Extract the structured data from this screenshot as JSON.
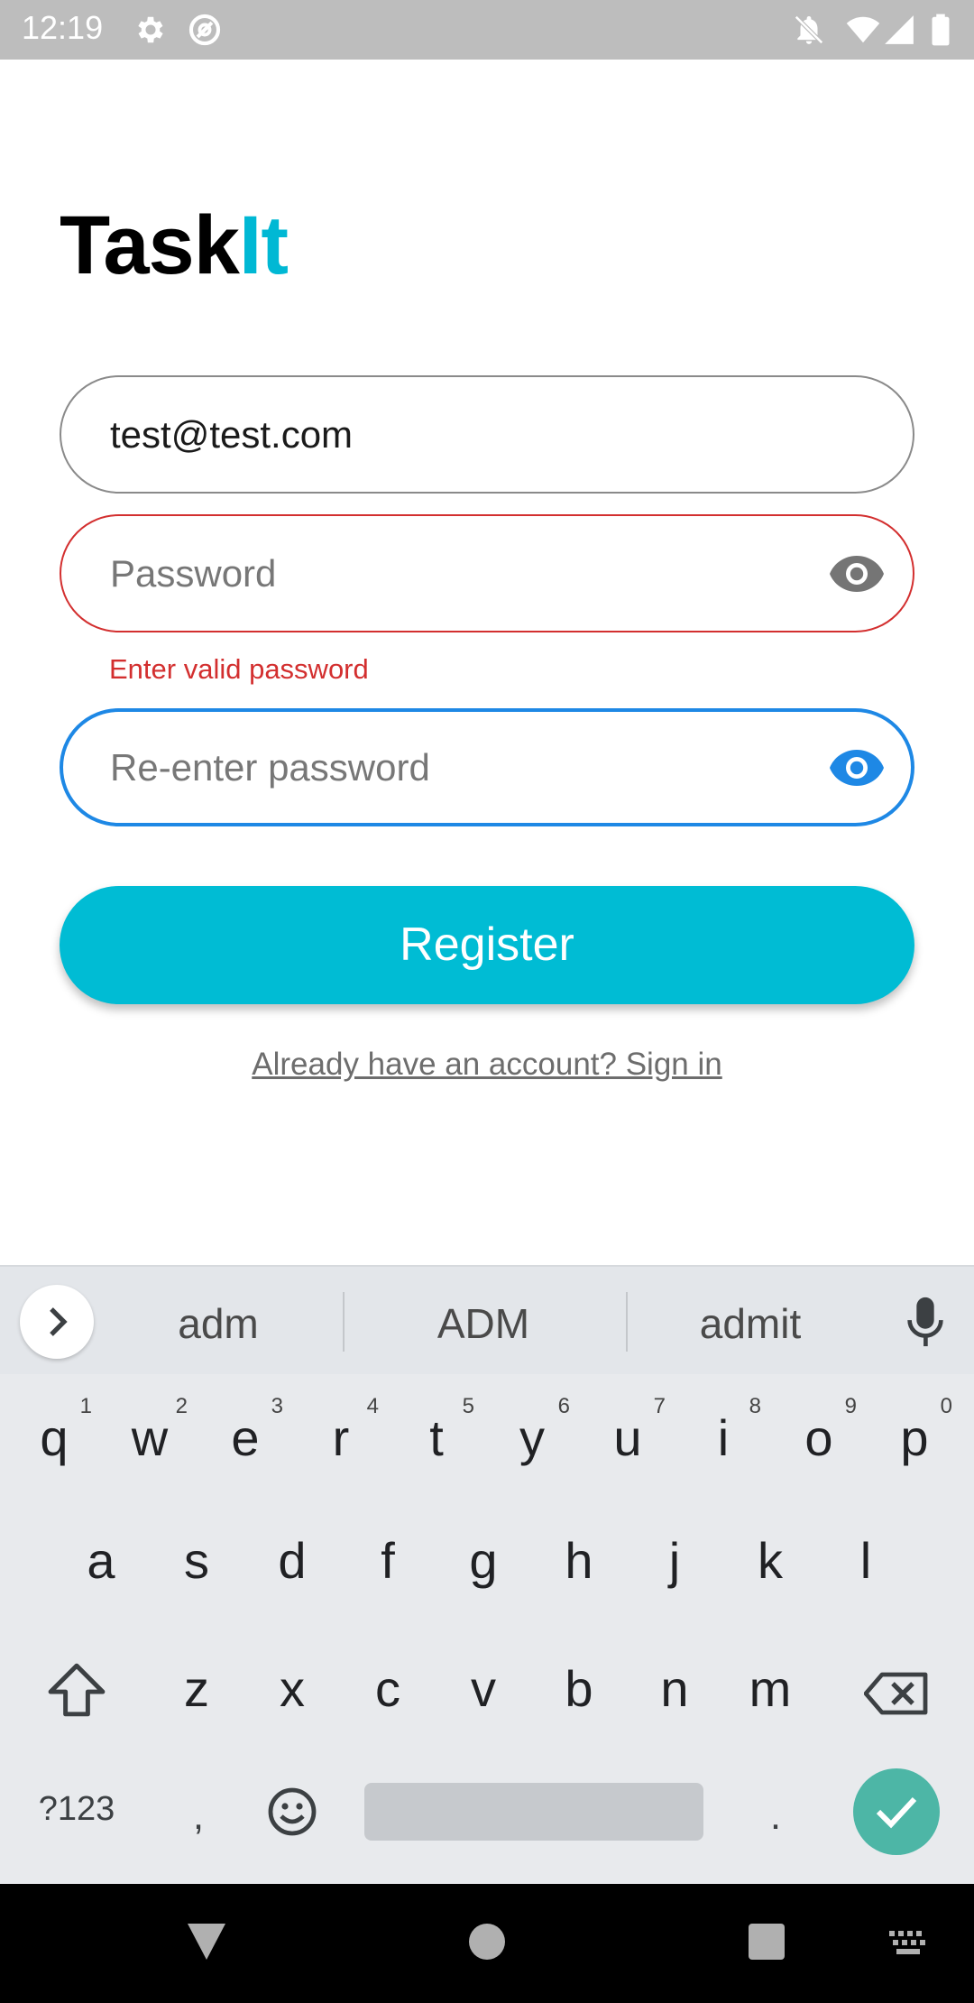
{
  "status_bar": {
    "time": "12:19",
    "left_icons": [
      "gear-icon",
      "at-sign-icon"
    ],
    "right_icons": [
      "notifications-off-icon",
      "wifi-icon",
      "signal-icon",
      "battery-icon"
    ]
  },
  "logo": {
    "part1": "Task",
    "part2": "It",
    "accent_color": "#00b8d4"
  },
  "form": {
    "email_value": "test@test.com",
    "password_placeholder": "Password",
    "password_error": "Enter valid password",
    "repassword_placeholder": "Re-enter password",
    "register_label": "Register",
    "signin_link": "Already have an account? Sign in",
    "error_color": "#d32f2f",
    "focus_color": "#1e88e5",
    "button_color": "#00bcd4"
  },
  "keyboard": {
    "suggestions": [
      "adm",
      "ADM",
      "admit"
    ],
    "row1": [
      {
        "key": "q",
        "hint": "1"
      },
      {
        "key": "w",
        "hint": "2"
      },
      {
        "key": "e",
        "hint": "3"
      },
      {
        "key": "r",
        "hint": "4"
      },
      {
        "key": "t",
        "hint": "5"
      },
      {
        "key": "y",
        "hint": "6"
      },
      {
        "key": "u",
        "hint": "7"
      },
      {
        "key": "i",
        "hint": "8"
      },
      {
        "key": "o",
        "hint": "9"
      },
      {
        "key": "p",
        "hint": "0"
      }
    ],
    "row2": [
      "a",
      "s",
      "d",
      "f",
      "g",
      "h",
      "j",
      "k",
      "l"
    ],
    "row3": [
      "z",
      "x",
      "c",
      "v",
      "b",
      "n",
      "m"
    ],
    "symbols_label": "?123",
    "comma": ",",
    "period": ".",
    "icons": [
      "chevron-right-icon",
      "mic-icon",
      "shift-icon",
      "backspace-icon",
      "emoji-icon",
      "checkmark-icon"
    ]
  },
  "nav_bar": {
    "icons": [
      "back-triangle-icon",
      "home-circle-icon",
      "recents-square-icon",
      "keyboard-icon"
    ]
  }
}
